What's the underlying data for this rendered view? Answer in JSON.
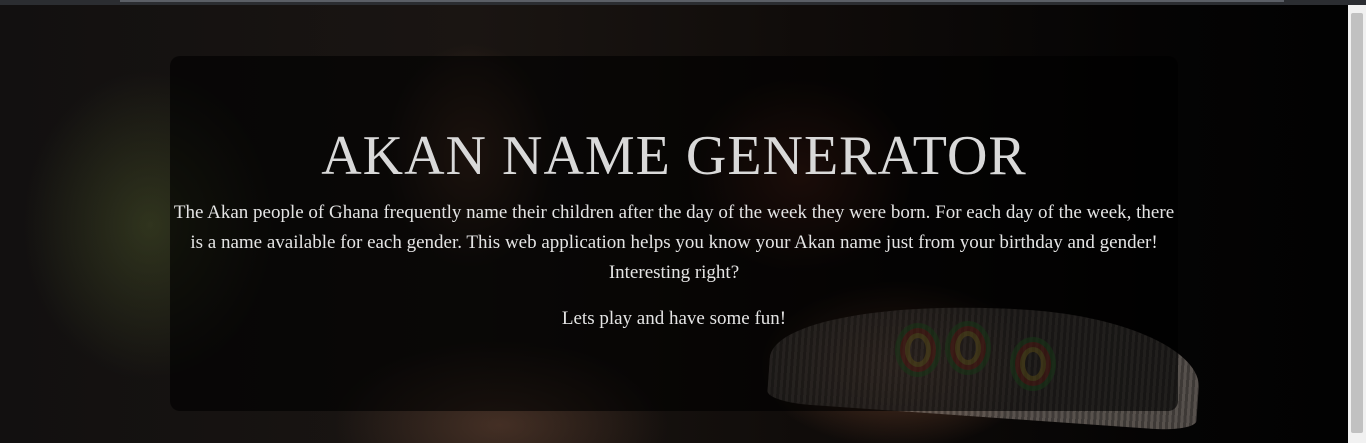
{
  "hero": {
    "title": "AKAN NAME GENERATOR",
    "intro": "The Akan people of Ghana frequently name their children after the day of the week they were born. For each day of the week, there is a name available for each gender. This web application helps you know your Akan name just from your birthday and gender! Interesting right?",
    "fun_line": "Lets play and have some fun!"
  },
  "colors": {
    "card_overlay": "#000000",
    "text": "#e4e4e4",
    "title_text": "#d9d9d9"
  }
}
